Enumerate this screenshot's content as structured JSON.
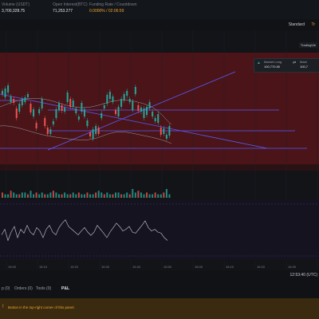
{
  "topbar": {
    "stats": [
      {
        "label": "Volume (USDT)",
        "value": "3,700,328.75",
        "value_color": "default"
      },
      {
        "label": "Open Interest(BTC)",
        "value": "71,253.277",
        "value_color": "default"
      },
      {
        "label": "Funding Rate / Countdown",
        "value": "0.0000% / 02:06:59",
        "value_color": "orange"
      }
    ]
  },
  "toolbar": {
    "standard_label": "Standard",
    "standard_arrow": "Tr"
  },
  "chart": {
    "tv_tag": "TradingVie",
    "market_long": {
      "label": "Market Long",
      "value": "100,770.50"
    },
    "market_short": {
      "label": "Mark",
      "value": "100,7"
    },
    "time_labels": [
      "15:00",
      "15:10",
      "15:20",
      "15:30",
      "15:40",
      "15:50",
      "16:00",
      "16:10",
      "16:20",
      "16:30",
      "16:40"
    ]
  },
  "status": {
    "timestamp": "12:53:40 (UTC)"
  },
  "tabs": {
    "items": [
      {
        "label": "p (0)",
        "active": false
      },
      {
        "label": "Orders (0)",
        "active": false
      },
      {
        "label": "Tools (0)",
        "active": false
      },
      {
        "label": "P&L",
        "active": true
      }
    ]
  },
  "notice": {
    "message": "Button in the top-right corner of this panel."
  },
  "colors": {
    "up": "#26a69a",
    "down": "#ef5350",
    "bg_red": "#4a1418",
    "line_blue": "#5b5bff",
    "line_purple": "#8a8aff",
    "accent": "#f0a72b"
  },
  "chart_data": {
    "type": "candlestick",
    "x": [
      "15:00",
      "15:10",
      "15:20",
      "15:30",
      "15:40",
      "15:50"
    ],
    "price": {
      "open": [
        5,
        5,
        5,
        6,
        6,
        5,
        4,
        5,
        5,
        6,
        7,
        6,
        6,
        5,
        6,
        6,
        5,
        4,
        4,
        5,
        6,
        6,
        5,
        5,
        5,
        4,
        4,
        4,
        5,
        5,
        5,
        5,
        4,
        4,
        4,
        3,
        3,
        4,
        5,
        5,
        5,
        4,
        4,
        4,
        4,
        5,
        5,
        5,
        5,
        4,
        4,
        4,
        5,
        5,
        5,
        6,
        6,
        5,
        5,
        6
      ],
      "close": [
        5,
        5,
        6,
        6,
        5,
        4,
        5,
        5,
        6,
        7,
        6,
        6,
        5,
        6,
        6,
        5,
        4,
        4,
        5,
        6,
        6,
        5,
        5,
        5,
        4,
        4,
        4,
        5,
        5,
        5,
        5,
        4,
        4,
        4,
        3,
        3,
        4,
        5,
        5,
        5,
        4,
        4,
        4,
        4,
        5,
        5,
        5,
        5,
        4,
        4,
        4,
        5,
        5,
        5,
        6,
        6,
        5,
        5,
        6,
        6
      ]
    },
    "volume": [
      3,
      2,
      2,
      4,
      3,
      2,
      2,
      3,
      3,
      2,
      4,
      2,
      3,
      2,
      3,
      2,
      2,
      3,
      4,
      3,
      2,
      2,
      3,
      2,
      2,
      3,
      2,
      3,
      2,
      2,
      3,
      2,
      2,
      3,
      4,
      3,
      2,
      3,
      2,
      2,
      3,
      3,
      2,
      2,
      3,
      2,
      5,
      3,
      4,
      3,
      2,
      3,
      2,
      2,
      3,
      2,
      2,
      3,
      5,
      2
    ],
    "rsi": [
      0.45,
      0.55,
      0.35,
      0.5,
      0.6,
      0.4,
      0.55,
      0.48,
      0.62,
      0.5,
      0.45,
      0.58,
      0.52,
      0.4,
      0.55,
      0.62,
      0.5,
      0.45,
      0.58,
      0.66,
      0.72,
      0.6,
      0.55,
      0.5,
      0.45,
      0.52,
      0.58,
      0.5,
      0.44,
      0.5,
      0.62,
      0.55,
      0.48,
      0.4,
      0.5,
      0.58,
      0.66,
      0.6,
      0.52,
      0.55,
      0.6,
      0.5,
      0.48,
      0.55,
      0.62,
      0.7,
      0.58,
      0.52,
      0.55,
      0.5,
      0.48,
      0.4,
      0.35
    ],
    "trendlines": "drawn"
  }
}
